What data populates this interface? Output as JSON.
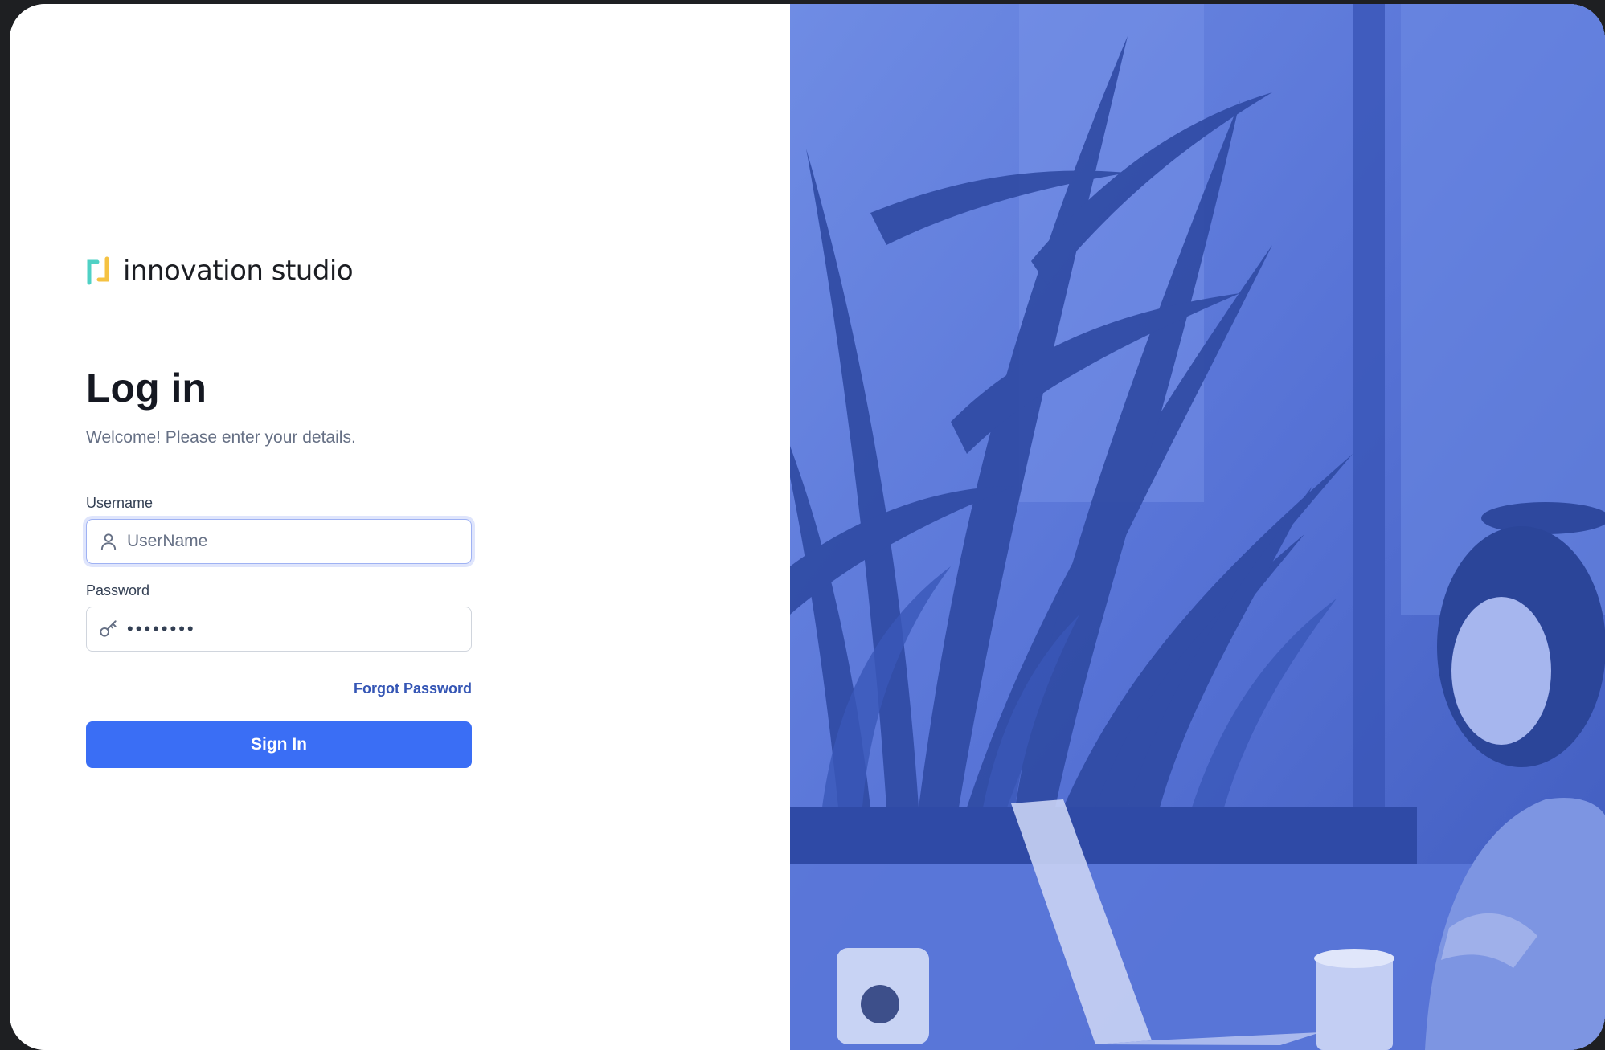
{
  "brand": {
    "name": "innovation studio",
    "colors": {
      "mark_yellow": "#f5c242",
      "mark_teal": "#4fd1c5"
    }
  },
  "login": {
    "title": "Log in",
    "subtitle": "Welcome! Please enter your details.",
    "username": {
      "label": "Username",
      "placeholder": "UserName",
      "value": "",
      "icon": "user-icon"
    },
    "password": {
      "label": "Password",
      "masked_value": "••••••••",
      "icon": "key-icon"
    },
    "forgot_label": "Forgot Password",
    "submit_label": "Sign In"
  },
  "hero": {
    "image": "office-plants-woman-laptop-photo",
    "tint_color": "#4f6bd2"
  },
  "colors": {
    "primary": "#3a6ef5",
    "link": "#3556b5",
    "heading": "#151821",
    "muted": "#667085"
  }
}
